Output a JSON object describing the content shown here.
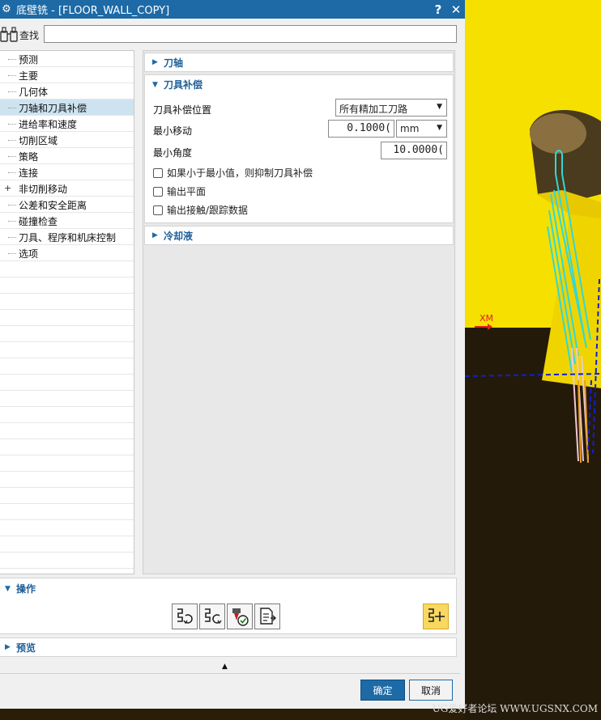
{
  "window": {
    "title": "底壁铣 - [FLOOR_WALL_COPY]",
    "help_label": "?",
    "close_label": "✕"
  },
  "search": {
    "label": "查找",
    "value": ""
  },
  "tree": {
    "items": [
      {
        "label": "预测",
        "expander": false
      },
      {
        "label": "主要",
        "expander": false
      },
      {
        "label": "几何体",
        "expander": false
      },
      {
        "label": "刀轴和刀具补偿",
        "expander": false,
        "selected": true
      },
      {
        "label": "进给率和速度",
        "expander": false
      },
      {
        "label": "切削区域",
        "expander": false
      },
      {
        "label": "策略",
        "expander": false
      },
      {
        "label": "连接",
        "expander": false
      },
      {
        "label": "非切削移动",
        "expander": true
      },
      {
        "label": "公差和安全距离",
        "expander": false
      },
      {
        "label": "碰撞检查",
        "expander": false
      },
      {
        "label": "刀具、程序和机床控制",
        "expander": false
      },
      {
        "label": "选项",
        "expander": false
      }
    ]
  },
  "sections": {
    "tool_axis": {
      "label": "刀轴",
      "expanded": false
    },
    "cutter_comp": {
      "label": "刀具补偿",
      "expanded": true,
      "position_label": "刀具补偿位置",
      "position_value": "所有精加工刀路",
      "min_move_label": "最小移动",
      "min_move_value": "0.1000(",
      "min_move_unit": "mm",
      "min_angle_label": "最小角度",
      "min_angle_value": "10.0000(",
      "checkboxes": [
        {
          "label": "如果小于最小值，则抑制刀具补偿",
          "checked": false
        },
        {
          "label": "输出平面",
          "checked": false
        },
        {
          "label": "输出接触/跟踪数据",
          "checked": false
        }
      ]
    },
    "coolant": {
      "label": "冷却液",
      "expanded": false
    }
  },
  "operations": {
    "label": "操作"
  },
  "preview": {
    "label": "预览"
  },
  "buttons": {
    "ok": "确定",
    "cancel": "取消"
  },
  "viewport": {
    "axis_label": "XM",
    "watermark": "UG爱好者论坛 WWW.UGSNX.COM"
  },
  "colors": {
    "titlebar": "#1d6aa6",
    "accent_text": "#1d5f99",
    "selected_row": "#cde3f0",
    "viewport_yellow": "#f5e000",
    "toolpath_cyan": "#30d8d8",
    "boundary_blue": "#1020d0",
    "axis_red": "#e02020"
  }
}
